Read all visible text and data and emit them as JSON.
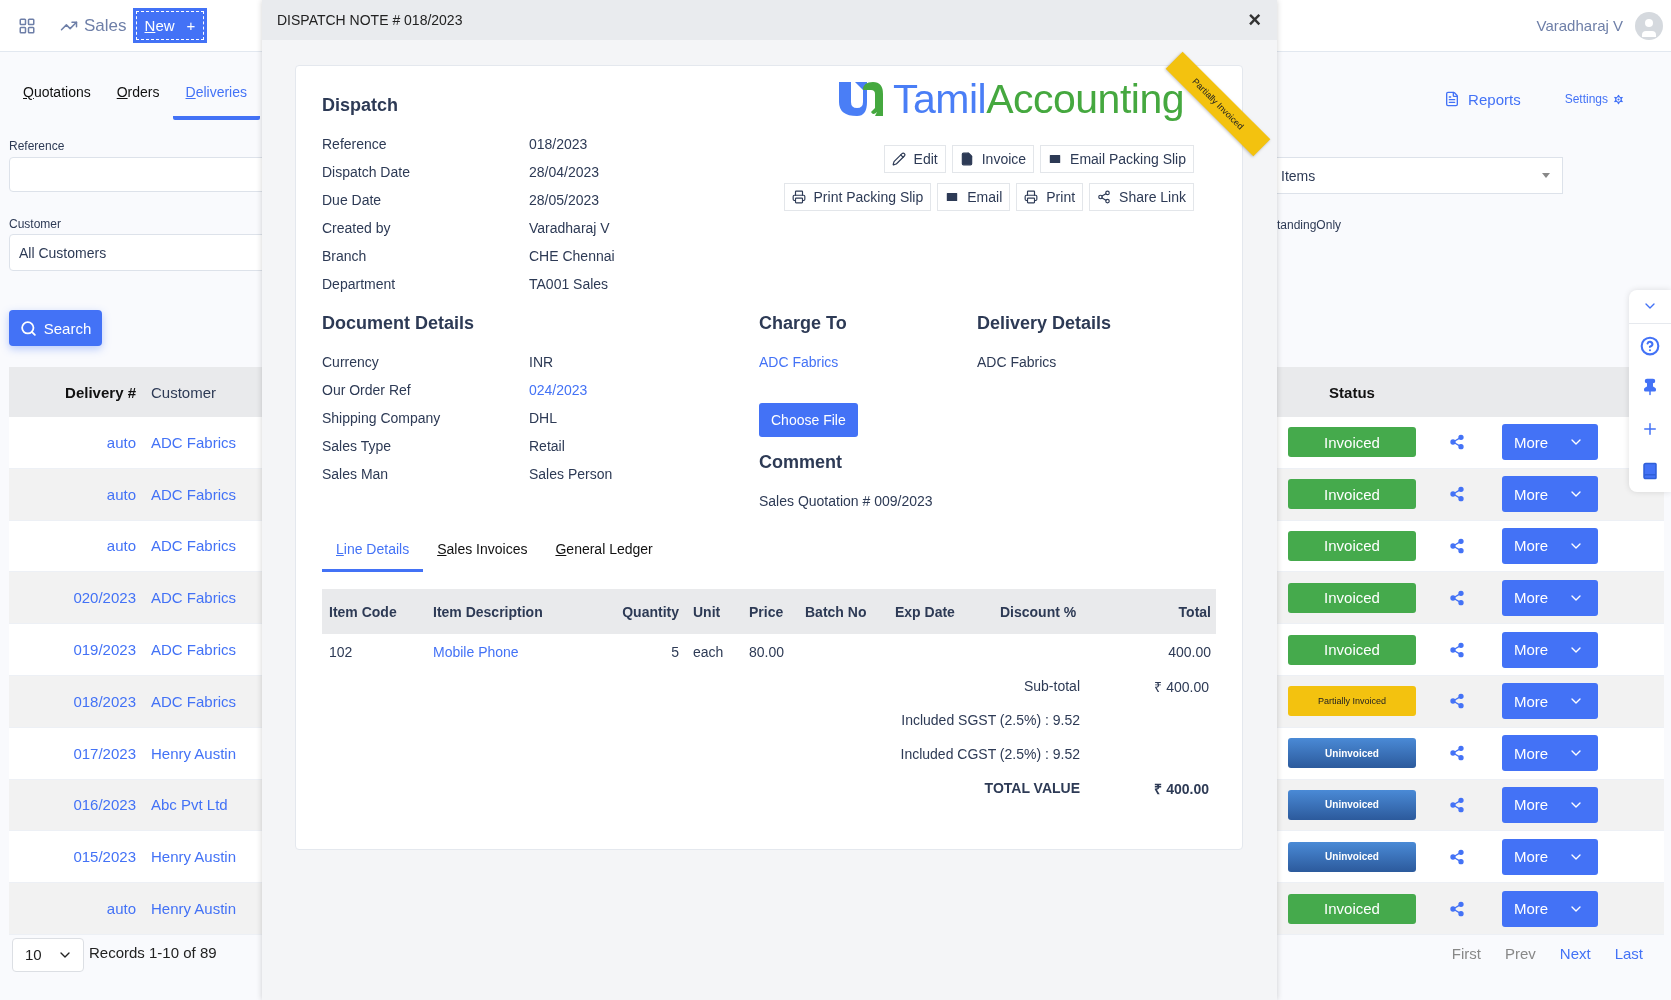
{
  "header": {
    "app": "Sales",
    "new_button": {
      "label": "New",
      "icon": "+"
    },
    "user": "Varadharaj V"
  },
  "tabs": [
    {
      "label": "Quotations",
      "selected": false
    },
    {
      "label": "Orders",
      "selected": false
    },
    {
      "label": "Deliveries",
      "selected": true
    }
  ],
  "filters": {
    "reference": {
      "label": "Reference"
    },
    "customer": {
      "label": "Customer",
      "value": "All Customers"
    },
    "items": {
      "value": "Items"
    },
    "outstanding": "tandingOnly",
    "search_button": "Search"
  },
  "links": {
    "reports": "Reports",
    "settings": "Settings"
  },
  "table": {
    "columns": [
      {
        "label": "Delivery #",
        "sorted": true
      },
      {
        "label": "Customer",
        "sorted": false
      },
      {
        "label": "Status",
        "sorted": true
      }
    ],
    "rows": [
      {
        "delivery": "auto",
        "customer": "ADC Fabrics",
        "status": {
          "label": "Invoiced",
          "kind": "invoiced"
        },
        "more": "More"
      },
      {
        "delivery": "auto",
        "customer": "ADC Fabrics",
        "status": {
          "label": "Invoiced",
          "kind": "invoiced"
        },
        "more": "More"
      },
      {
        "delivery": "auto",
        "customer": "ADC Fabrics",
        "status": {
          "label": "Invoiced",
          "kind": "invoiced"
        },
        "more": "More"
      },
      {
        "delivery": "020/2023",
        "customer": "ADC Fabrics",
        "status": {
          "label": "Invoiced",
          "kind": "invoiced"
        },
        "more": "More"
      },
      {
        "delivery": "019/2023",
        "customer": "ADC Fabrics",
        "status": {
          "label": "Invoiced",
          "kind": "invoiced"
        },
        "more": "More"
      },
      {
        "delivery": "018/2023",
        "customer": "ADC Fabrics",
        "status": {
          "label": "Partially Invoiced",
          "kind": "partial"
        },
        "more": "More"
      },
      {
        "delivery": "017/2023",
        "customer": "Henry Austin",
        "status": {
          "label": "Uninvoiced",
          "kind": "uninvoiced"
        },
        "more": "More"
      },
      {
        "delivery": "016/2023",
        "customer": "Abc Pvt Ltd",
        "status": {
          "label": "Uninvoiced",
          "kind": "uninvoiced"
        },
        "more": "More"
      },
      {
        "delivery": "015/2023",
        "customer": "Henry Austin",
        "status": {
          "label": "Uninvoiced",
          "kind": "uninvoiced"
        },
        "more": "More"
      },
      {
        "delivery": "auto",
        "customer": "Henry Austin",
        "status": {
          "label": "Invoiced",
          "kind": "invoiced"
        },
        "more": "More"
      }
    ]
  },
  "pagination": {
    "page_size": "10",
    "records": "Records 1-10 of 89",
    "links": [
      {
        "label": "First",
        "disabled": true
      },
      {
        "label": "Prev",
        "disabled": true
      },
      {
        "label": "Next",
        "disabled": false
      },
      {
        "label": "Last",
        "disabled": false
      }
    ]
  },
  "modal": {
    "title": "DISPATCH NOTE # 018/2023",
    "close": "×",
    "ribbon": "Partially Invoiced",
    "logo": {
      "part_1": "Tamil",
      "part_2": "Accounting"
    },
    "actions": [
      [
        {
          "label": "Edit",
          "kind": "edit"
        },
        {
          "label": "Invoice",
          "kind": "invoice"
        },
        {
          "label": "Email Packing Slip",
          "kind": "email"
        }
      ],
      [
        {
          "label": "Print Packing Slip",
          "kind": "print"
        },
        {
          "label": "Email",
          "kind": "email"
        },
        {
          "label": "Print",
          "kind": "print"
        },
        {
          "label": "Share Link",
          "kind": "share"
        }
      ]
    ],
    "dispatch": {
      "heading": "Dispatch",
      "fields": [
        {
          "label": "Reference",
          "value": "018/2023"
        },
        {
          "label": "Dispatch Date",
          "value": "28/04/2023"
        },
        {
          "label": "Due Date",
          "value": "28/05/2023"
        },
        {
          "label": "Created by",
          "value": "Varadharaj V"
        },
        {
          "label": "Branch",
          "value": "CHE Chennai"
        },
        {
          "label": "Department",
          "value": "TA001 Sales"
        }
      ]
    },
    "document": {
      "heading": "Document Details",
      "fields": [
        {
          "label": "Currency",
          "value": "INR",
          "link": false
        },
        {
          "label": "Our Order Ref",
          "value": "024/2023",
          "link": true
        },
        {
          "label": "Shipping Company",
          "value": "DHL",
          "link": false
        },
        {
          "label": "Sales Type",
          "value": "Retail",
          "link": false
        },
        {
          "label": "Sales Man",
          "value": "Sales Person",
          "link": false
        }
      ]
    },
    "charge_to": {
      "heading": "Charge To",
      "value": "ADC Fabrics"
    },
    "choose_file": "Choose File",
    "comment": {
      "heading": "Comment",
      "text": "Sales Quotation # 009/2023"
    },
    "delivery": {
      "heading": "Delivery Details",
      "value": "ADC Fabrics"
    },
    "detail_tabs": [
      {
        "label": "Line Details",
        "selected": true
      },
      {
        "label": "Sales Invoices",
        "selected": false
      },
      {
        "label": "General Ledger",
        "selected": false
      }
    ],
    "lines": {
      "columns": [
        "Item Code",
        "Item Description",
        "Quantity",
        "Unit",
        "Price",
        "Batch No",
        "Exp Date",
        "Discount %",
        "Total"
      ],
      "rows": [
        {
          "item_code": "102",
          "description": "Mobile Phone",
          "quantity": "5",
          "unit": "each",
          "price": "80.00",
          "total": "400.00"
        }
      ]
    },
    "totals": [
      {
        "label": "Sub-total",
        "value": "₹ 400.00",
        "kind": "sub"
      },
      {
        "label": "Included SGST (2.5%) : 9.52",
        "kind": "tax"
      },
      {
        "label": "Included CGST (2.5%) : 9.52",
        "kind": "tax"
      },
      {
        "label": "TOTAL VALUE",
        "value": "₹ 400.00",
        "kind": "grand"
      }
    ]
  }
}
